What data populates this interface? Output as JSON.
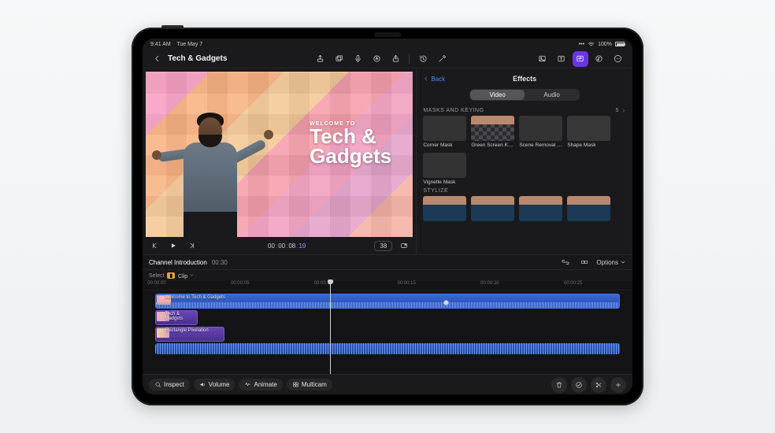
{
  "status": {
    "time": "9:41 AM",
    "date": "Tue May 7",
    "battery_pct": "100%"
  },
  "project": {
    "title": "Tech & Gadgets"
  },
  "viewer": {
    "pretitle": "WELCOME TO",
    "title_line1": "Tech &",
    "title_line2": "Gadgets",
    "timecode": {
      "hh": "00",
      "mm": "00",
      "ss": "08",
      "ff": "19"
    },
    "zoom": "38"
  },
  "effects": {
    "back": "Back",
    "title": "Effects",
    "tabs": {
      "video": "Video",
      "audio": "Audio"
    },
    "sections": {
      "masks": {
        "label": "MASKS AND KEYING",
        "count": "5",
        "items": [
          {
            "label": "Corner Mask"
          },
          {
            "label": "Green Screen Keyer"
          },
          {
            "label": "Scene Removal Mask"
          },
          {
            "label": "Shape Mask"
          },
          {
            "label": "Vignette Mask"
          }
        ]
      },
      "stylize": {
        "label": "STYLIZE"
      }
    }
  },
  "project_bar": {
    "name": "Channel Introduction",
    "duration": "00:30",
    "options": "Options"
  },
  "select_row": {
    "label": "Select",
    "chip": "◧",
    "clip": "Clip"
  },
  "ruler": [
    {
      "t": "00:00:00",
      "pct": 1
    },
    {
      "t": "00:00:05",
      "pct": 18
    },
    {
      "t": "00:00:10",
      "pct": 35
    },
    {
      "t": "00:00:15",
      "pct": 52
    },
    {
      "t": "00:00:20",
      "pct": 69
    },
    {
      "t": "00:00:25",
      "pct": 86
    }
  ],
  "timeline": {
    "clips": {
      "main": "Welcome to Tech & Gadgets",
      "title": "Tech & Gadgets",
      "rect": "Rectangle Pixelation"
    }
  },
  "bottom": {
    "inspect": "Inspect",
    "volume": "Volume",
    "animate": "Animate",
    "multicam": "Multicam"
  }
}
